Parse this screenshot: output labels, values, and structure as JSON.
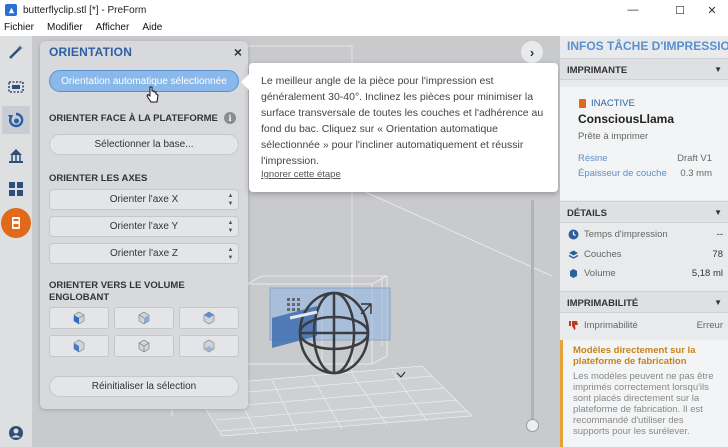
{
  "window": {
    "title": "butterflyclip.stl [*] - PreForm",
    "minimize": "—",
    "maximize": "☐",
    "close": "✕"
  },
  "menu": [
    "Fichier",
    "Modifier",
    "Afficher",
    "Aide"
  ],
  "orientation_panel": {
    "title": "ORIENTATION",
    "close": "×",
    "auto_button": "Orientation automatique sélectionnée",
    "face_section": "ORIENTER FACE À LA PLATEFORME",
    "info": "i",
    "select_base": "Sélectionner la base...",
    "axes_section": "ORIENTER LES AXES",
    "axis_x": "Orienter l'axe X",
    "axis_y": "Orienter l'axe Y",
    "axis_z": "Orienter l'axe Z",
    "volume_section": "ORIENTER VERS LE VOLUME ENGLOBANT",
    "reset": "Réinitialiser la sélection"
  },
  "tooltip": {
    "text": "Le meilleur angle de la pièce pour l'impression est généralement 30-40°. Inclinez les pièces pour minimiser la surface transversale de toutes les couches et l'adhérence au fond du bac. Cliquez sur « Orientation automatique sélectionnée » pour l'incliner automatiquement et réussir l'impression.",
    "skip": "Ignorer cette étape"
  },
  "job_panel": {
    "title": "INFOS TÂCHE D'IMPRESSION",
    "printer_section": "IMPRIMANTE",
    "status_badge": "INACTIVE",
    "printer_name": "ConsciousLlama",
    "printer_status": "Prête à imprimer",
    "resin_label": "Résine",
    "resin_value": "Draft V1",
    "layer_label": "Épaisseur de couche",
    "layer_value": "0.3 mm",
    "details_section": "DÉTAILS",
    "time_label": "Temps d'impression",
    "time_value": "--",
    "layers_label": "Couches",
    "layers_value": "78",
    "volume_label": "Volume",
    "volume_value": "5,18 ml",
    "printability_section": "IMPRIMABILITÉ",
    "printability_label": "Imprimabilité",
    "printability_value": "Erreur",
    "warning_title": "Modèles directement sur la plateforme de fabrication",
    "warning_text": "Les modèles peuvent ne pas être imprimés correctement lorsqu'ils sont placés directement sur la plateforme de fabrication. Il est recommandé d'utiliser des supports pour les surélever."
  },
  "colors": {
    "accent": "#2c5fa2",
    "button_blue": "#8bb8ea",
    "warning": "#e7a13a",
    "error_icon": "#c0392b",
    "active_tool": "#e06a1a"
  }
}
